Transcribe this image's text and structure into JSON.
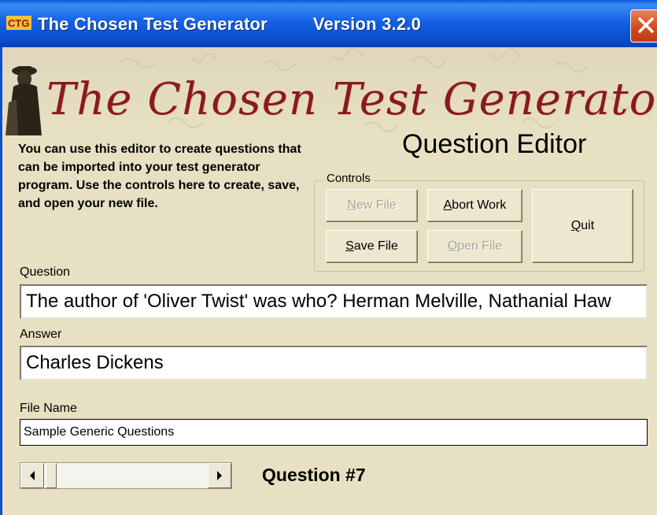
{
  "window": {
    "title": "The Chosen Test Generator",
    "version": "Version 3.2.0",
    "icon": "app-icon",
    "close_icon": "close-icon"
  },
  "banner": {
    "logo_text": "The Chosen Test Generator"
  },
  "intro_text": "You can use this editor to create questions that can be imported into your test generator program.  Use the controls here to create, save, and open your new file.",
  "editor_title": "Question Editor",
  "controls": {
    "legend": "Controls",
    "new_file": {
      "label": "New File",
      "mnemonic": "N",
      "rest": "ew File",
      "enabled": false
    },
    "abort_work": {
      "label": "Abort Work",
      "mnemonic": "A",
      "rest": "bort Work",
      "enabled": true
    },
    "save_file": {
      "label": "Save File",
      "mnemonic": "S",
      "rest": "ave File",
      "enabled": true
    },
    "open_file": {
      "label": "Open File",
      "mnemonic": "O",
      "rest": "pen File",
      "enabled": false
    },
    "quit": {
      "label": "Quit",
      "mnemonic": "Q",
      "rest": "uit",
      "enabled": true
    }
  },
  "question": {
    "label": "Question",
    "value": "The author of 'Oliver Twist' was who? Herman Melville, Nathanial Haw"
  },
  "answer": {
    "label": "Answer",
    "value": "Charles Dickens"
  },
  "file_name": {
    "label": "File Name",
    "value": "Sample Generic Questions"
  },
  "navigator": {
    "left_icon": "arrow-left-icon",
    "right_icon": "arrow-right-icon",
    "question_number": "Question #7"
  },
  "colors": {
    "title_bar": "#0a4fd0",
    "client_bg": "#e8e0c2",
    "logo_red": "#8b1a1a"
  }
}
